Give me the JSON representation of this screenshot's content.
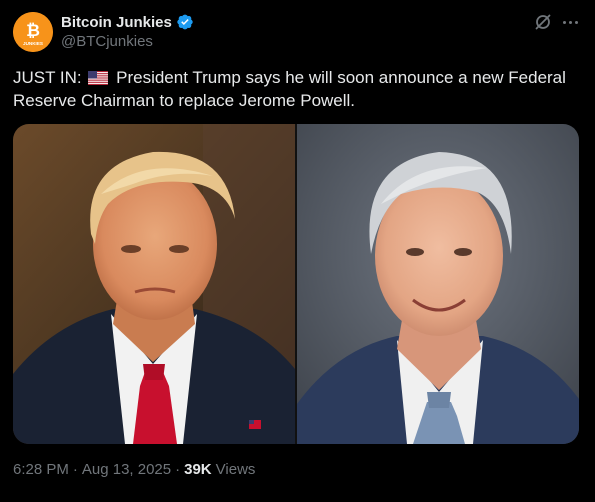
{
  "account": {
    "display_name": "Bitcoin Junkies",
    "handle": "@BTCjunkies",
    "avatar_text": "JUNKIES",
    "avatar_color": "#f7931a",
    "verified": true
  },
  "tweet": {
    "prefix": "JUST IN:",
    "flag_icon": "us-flag-emoji",
    "text": "President Trump says he will soon announce a new Federal Reserve Chairman to replace Jerome Powell."
  },
  "media": {
    "left_image": "portrait-donald-trump",
    "right_image": "portrait-jerome-powell"
  },
  "footer": {
    "time": "6:28 PM",
    "separator": "·",
    "date": "Aug 13, 2025",
    "views_count": "39K",
    "views_label": "Views"
  },
  "colors": {
    "background": "#000000",
    "text_primary": "#e7e9ea",
    "text_secondary": "#71767b",
    "verified_blue": "#1d9bf0"
  },
  "icons": {
    "grok": "grok-icon",
    "more": "more-icon"
  }
}
